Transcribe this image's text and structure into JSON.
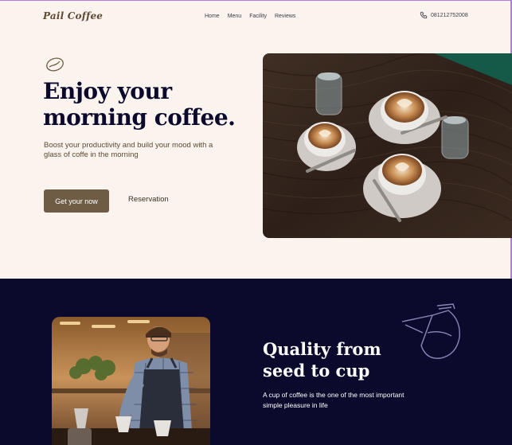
{
  "header": {
    "logo": "Pail Coffee",
    "nav": [
      "Home",
      "Menu",
      "Facility",
      "Reviews"
    ],
    "phone": "081212752008"
  },
  "hero": {
    "headline_line1": "Enjoy your",
    "headline_line2": "morning coffee.",
    "subtext": "Boost your productivity and build your mood with a glass of coffe in the morning",
    "primary_button": "Get your now",
    "secondary_button": "Reservation"
  },
  "quality": {
    "title_line1": "Quality from",
    "title_line2": "seed to cup",
    "text": "A cup of coffee is the one of the most important simple pleasure in life"
  },
  "colors": {
    "hero_bg": "#fbf4ee",
    "dark_bg": "#0b0a2c",
    "accent_brown": "#6e5d44",
    "heading_navy": "#0b0a2c"
  },
  "icons": [
    "coffee-bean-icon",
    "phone-icon",
    "coffee-pot-icon"
  ]
}
